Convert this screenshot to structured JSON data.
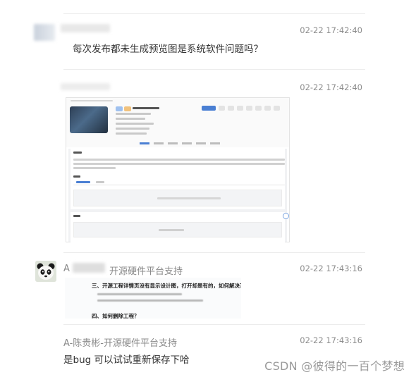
{
  "messages": [
    {
      "time": "02-22 17:42:40",
      "text": "每次发布都未生成预览图是系统软件问题吗？"
    },
    {
      "time": "02-22 17:42:40",
      "attachment": "screenshot"
    },
    {
      "time": "02-22 17:43:16",
      "name_prefix": "A",
      "name_suffix": "开源硬件平台支持",
      "attachment_heading": "三、开源工程详情页没有显示设计图，打开却是有的，如何解决？",
      "attachment_cut": "四、如何删除工程？"
    },
    {
      "time": "02-22 17:43:16",
      "name": "A-陈贵彬-开源硬件平台支持",
      "text": "是bug  可以试试重新保存下哈"
    }
  ],
  "watermark": "CSDN @彼得的一百个梦想",
  "colors": {
    "timestamp": "#8c8c8c",
    "name": "#8a8a8a",
    "text": "#333333",
    "link": "#4a7fd3"
  },
  "icons": {
    "avatar_2": "panda-avatar"
  }
}
